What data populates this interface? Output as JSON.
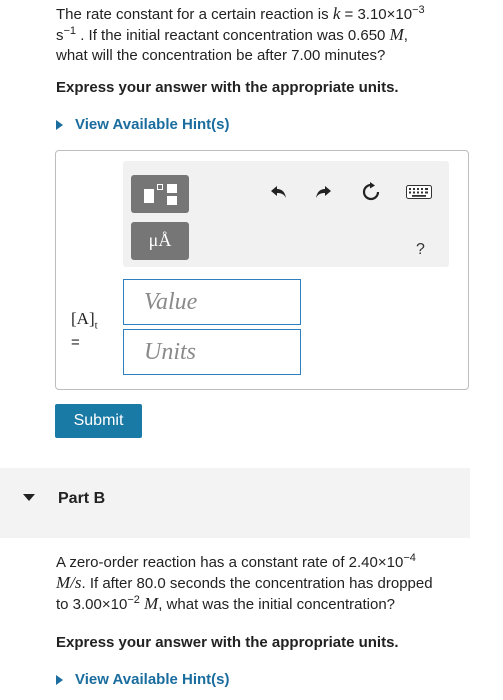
{
  "part_a": {
    "question": {
      "t1": "The rate constant for a certain reaction is ",
      "k_var": "k",
      "t2": " = 3.10×10",
      "k_exp": "−3",
      "t3": "s",
      "s_exp": "−1",
      "t4": " . If the initial reactant concentration was 0.650 ",
      "M_var": "M",
      "t5": ",",
      "t6": "what will the concentration be after 7.00 minutes?"
    },
    "instruction": "Express your answer with the appropriate units.",
    "hint_label": "View Available Hint(s)",
    "toolbar": {
      "units_label": "μÅ",
      "help_label": "?"
    },
    "variable_label": "[A]",
    "variable_sub": "t",
    "equals": "=",
    "value_placeholder": "Value",
    "units_placeholder": "Units",
    "submit_label": "Submit"
  },
  "part_b": {
    "title": "Part B",
    "question": {
      "t1": "A zero-order reaction has a constant rate of 2.40×10",
      "r_exp": "−4",
      "unit": "M/s",
      "t2": ". If after 80.0 seconds the concentration has dropped",
      "t3": "to 3.00×10",
      "c_exp": "−2",
      "t4": " ",
      "M_var": "M",
      "t5": ", what was the initial concentration?"
    },
    "instruction": "Express your answer with the appropriate units.",
    "hint_label": "View Available Hint(s)"
  },
  "colors": {
    "link": "#1a6d9e",
    "submit_bg": "#1a7aa6",
    "input_border": "#2f7fbf",
    "toolbar_button": "#767676"
  }
}
